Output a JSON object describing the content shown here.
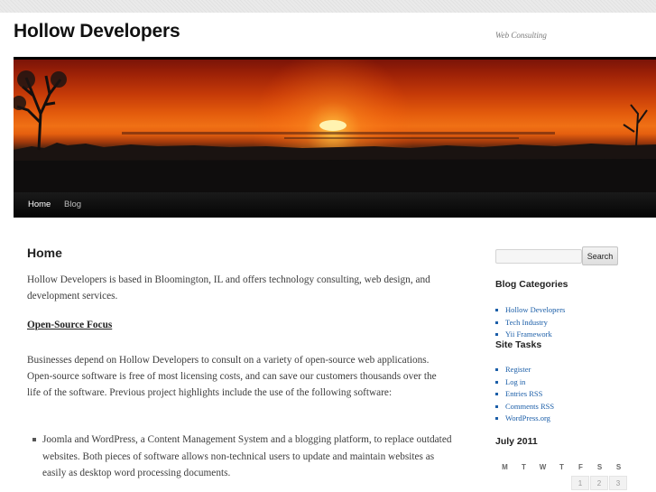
{
  "site": {
    "title": "Hollow Developers",
    "description": "Web Consulting"
  },
  "nav": {
    "items": [
      {
        "label": "Home"
      },
      {
        "label": "Blog"
      }
    ]
  },
  "main": {
    "title": "Home",
    "intro": "Hollow Developers is based in Bloomington, IL and offers technology consulting, web design, and development services.",
    "section_heading": "Open-Source Focus",
    "paragraph": "Businesses depend on Hollow Developers to consult on a variety of open-source web applications. Open-source software is free of most licensing costs, and can save our customers thousands over the life of the software. Previous project highlights include the use of the following software:",
    "list": [
      "Joomla and WordPress, a Content Management System and a blogging platform, to replace outdated websites.  Both pieces of software allows non-technical users to update and maintain websites as easily as desktop word processing documents."
    ]
  },
  "sidebar": {
    "search": {
      "value": "",
      "button_label": "Search"
    },
    "categories": {
      "title": "Blog Categories",
      "items": [
        "Hollow Developers",
        "Tech Industry",
        "Yii Framework"
      ]
    },
    "tasks": {
      "title": "Site Tasks",
      "items": [
        "Register",
        "Log in",
        "Entries RSS",
        "Comments RSS",
        "WordPress.org"
      ]
    },
    "calendar": {
      "title": "July 2011",
      "weekdays": [
        "M",
        "T",
        "W",
        "T",
        "F",
        "S",
        "S"
      ],
      "first_row": [
        "1",
        "2",
        "3"
      ]
    }
  },
  "colors": {
    "link": "#1b5ea8",
    "nav_bg": "#0b0b0b"
  }
}
